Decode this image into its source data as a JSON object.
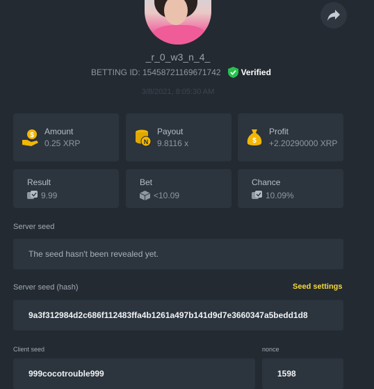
{
  "header": {
    "username": "_r_0_w3_n_4_",
    "betting_id": "BETTING ID: 15458721169671742",
    "verified_label": "Verified",
    "timestamp": "3/8/2021, 8:05:30 AM",
    "share_icon": "share-icon"
  },
  "stats": {
    "amount": {
      "label": "Amount",
      "value": "0.25 XRP",
      "icon": "money-hand-icon"
    },
    "payout": {
      "label": "Payout",
      "value": "9.8116 x",
      "icon": "coins-icon"
    },
    "profit": {
      "label": "Profit",
      "value": "+2.20290000 XRP",
      "icon": "money-bag-icon"
    },
    "result": {
      "label": "Result",
      "value": "9.99",
      "icon": "dice-icon"
    },
    "bet": {
      "label": "Bet",
      "value": "<10.09",
      "icon": "dice-box-icon"
    },
    "chance": {
      "label": "Chance",
      "value": "10.09%",
      "icon": "dice-icon"
    }
  },
  "server_seed": {
    "label": "Server seed",
    "value": "The seed hasn't been revealed yet."
  },
  "server_seed_hash": {
    "label": "Server seed (hash)",
    "settings_link": "Seed settings",
    "value": "9a3f312984d2c686f112483ffa4b1261a497b141d9d7e3660347a5bedd1d8"
  },
  "client_seed": {
    "label": "Client seed",
    "value": "999cocotrouble999"
  },
  "nonce": {
    "label": "nonce",
    "value": "1598"
  },
  "colors": {
    "background": "#232a32",
    "card": "#2c343d",
    "accent": "#f5d83a",
    "verified": "#27c24c"
  }
}
